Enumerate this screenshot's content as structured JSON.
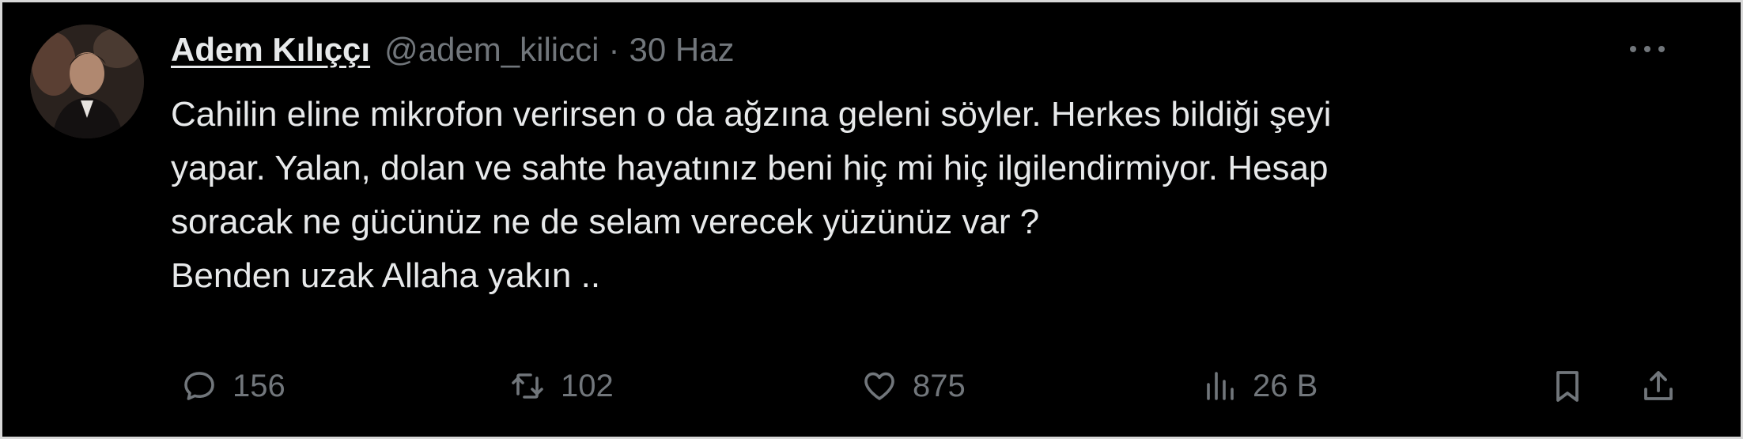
{
  "tweet": {
    "author_name": "Adem Kılıççı",
    "handle": "@adem_kilicci",
    "separator": "·",
    "date": "30 Haz",
    "lines": [
      "Cahilin eline mikrofon verirsen o da ağzına geleni söyler. Herkes bildiği şeyi",
      "yapar. Yalan, dolan ve sahte hayatınız beni hiç mi hiç ilgilendirmiyor. Hesap",
      "soracak ne gücünüz ne de selam verecek yüzünüz var ?",
      "Benden uzak Allaha yakın .."
    ]
  },
  "actions": {
    "reply_count": "156",
    "retweet_count": "102",
    "like_count": "875",
    "views_count": "26 B"
  },
  "icons": {
    "more": "more-horizontal-icon",
    "reply": "reply-icon",
    "retweet": "retweet-icon",
    "like": "heart-icon",
    "views": "views-chart-icon",
    "bookmark": "bookmark-icon",
    "share": "share-icon"
  },
  "colors": {
    "background": "#000000",
    "text_primary": "#e7e9ea",
    "text_secondary": "#71767b"
  }
}
